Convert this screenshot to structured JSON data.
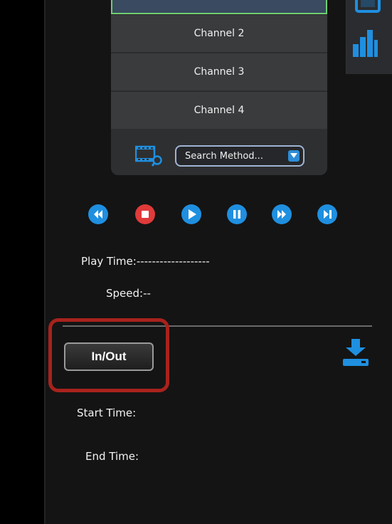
{
  "channels": {
    "items": [
      {
        "label": "Channel 2"
      },
      {
        "label": "Channel 3"
      },
      {
        "label": "Channel 4"
      }
    ],
    "search_method": {
      "value": "Search Method..."
    }
  },
  "playback": {
    "buttons": [
      "rewind",
      "stop",
      "play",
      "pause",
      "fast-forward",
      "next-frame"
    ],
    "play_time_label": "Play Time:",
    "play_time_value": "-------------------",
    "speed_label": "Speed:",
    "speed_value": "--"
  },
  "clip": {
    "inout_label": "In/Out",
    "start_time_label": "Start Time:",
    "end_time_label": "End Time:"
  },
  "colors": {
    "accent_blue": "#1f8fe0",
    "stop_red": "#e03a3a",
    "highlight_red": "#a8221c",
    "selected_border": "#6fcf6f"
  },
  "icons": {
    "strip": [
      "screen-icon",
      "bar-chart-icon"
    ],
    "search": "film-search-icon",
    "download": "download-icon"
  }
}
